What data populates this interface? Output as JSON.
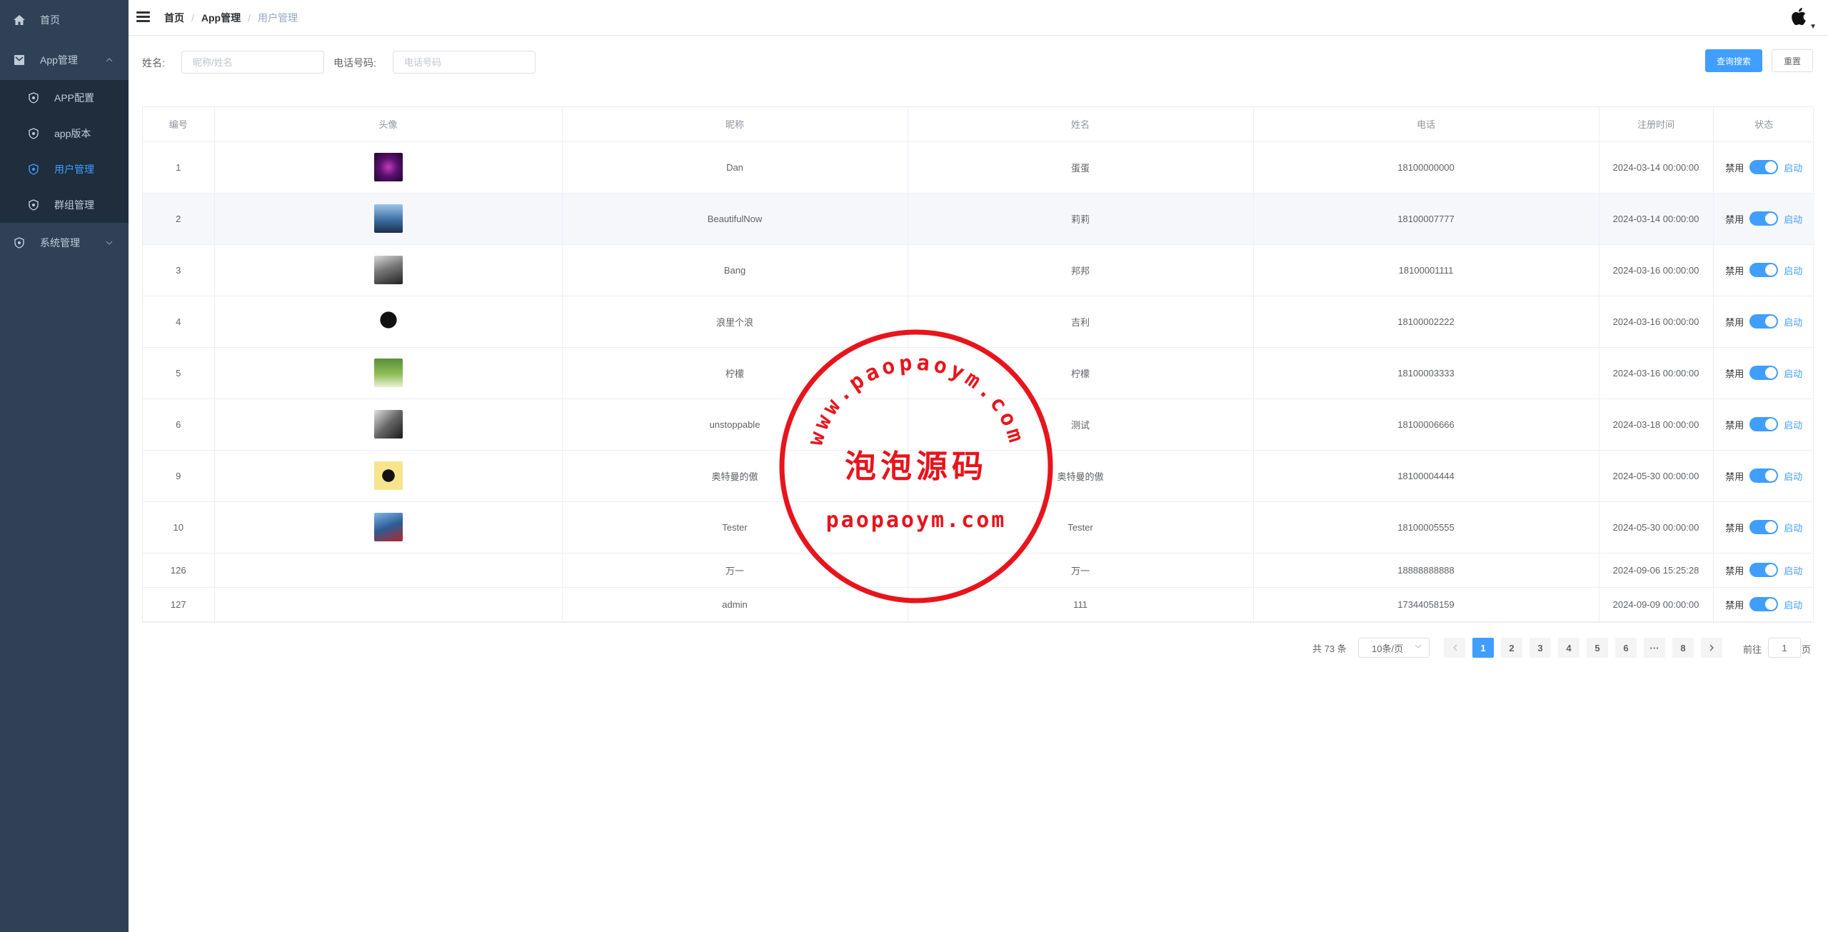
{
  "sidebar": {
    "items": [
      {
        "label": "首页",
        "icon": "home-icon"
      },
      {
        "label": "App管理",
        "icon": "app-icon",
        "expanded": true
      },
      {
        "label": "系统管理",
        "icon": "shield-icon",
        "expanded": false
      }
    ],
    "submenu": [
      {
        "label": "APP配置",
        "active": false
      },
      {
        "label": "app版本",
        "active": false
      },
      {
        "label": "用户管理",
        "active": true
      },
      {
        "label": "群组管理",
        "active": false
      }
    ]
  },
  "navbar": {
    "breadcrumb": [
      "首页",
      "App管理",
      "用户管理"
    ]
  },
  "search": {
    "name_label": "姓名:",
    "name_placeholder": "昵称/姓名",
    "phone_label": "电话号码:",
    "phone_placeholder": "电话号码",
    "search_button": "查询搜索",
    "reset_button": "重置"
  },
  "table": {
    "headers": [
      "编号",
      "头像",
      "昵称",
      "姓名",
      "电话",
      "注册时间",
      "状态"
    ],
    "rows": [
      {
        "id": "1",
        "nickname": "Dan",
        "name": "蛋蛋",
        "phone": "18100000000",
        "time": "2024-03-14 00:00:00",
        "has_avatar": true
      },
      {
        "id": "2",
        "nickname": "BeautifulNow",
        "name": "莉莉",
        "phone": "18100007777",
        "time": "2024-03-14 00:00:00",
        "has_avatar": true
      },
      {
        "id": "3",
        "nickname": "Bang",
        "name": "邦邦",
        "phone": "18100001111",
        "time": "2024-03-16 00:00:00",
        "has_avatar": true
      },
      {
        "id": "4",
        "nickname": "浪里个浪",
        "name": "吉利",
        "phone": "18100002222",
        "time": "2024-03-16 00:00:00",
        "has_avatar": true
      },
      {
        "id": "5",
        "nickname": "柠檬",
        "name": "柠檬",
        "phone": "18100003333",
        "time": "2024-03-16 00:00:00",
        "has_avatar": true
      },
      {
        "id": "6",
        "nickname": "unstoppable",
        "name": "测试",
        "phone": "18100006666",
        "time": "2024-03-18 00:00:00",
        "has_avatar": true
      },
      {
        "id": "9",
        "nickname": "奥特曼的傲",
        "name": "奥特曼的傲",
        "phone": "18100004444",
        "time": "2024-05-30 00:00:00",
        "has_avatar": true
      },
      {
        "id": "10",
        "nickname": "Tester",
        "name": "Tester",
        "phone": "18100005555",
        "time": "2024-05-30 00:00:00",
        "has_avatar": true
      },
      {
        "id": "126",
        "nickname": "万一",
        "name": "万一",
        "phone": "18888888888",
        "time": "2024-09-06 15:25:28",
        "has_avatar": false
      },
      {
        "id": "127",
        "nickname": "admin",
        "name": "111",
        "phone": "17344058159",
        "time": "2024-09-09 00:00:00",
        "has_avatar": false
      }
    ],
    "status_off": "禁用",
    "status_on": "启动",
    "status_enabled": true
  },
  "pagination": {
    "total": "共 73 条",
    "page_size": "10条/页",
    "pages": [
      "1",
      "2",
      "3",
      "4",
      "5",
      "6",
      "···",
      "8"
    ],
    "current": "1",
    "goto_label": "前往",
    "goto_value": "1",
    "page_unit": "页"
  },
  "watermark": {
    "arc_text": "www.paopaoym.com",
    "center_text": "泡泡源码",
    "bottom_text": "paopaoym.com",
    "color": "#e8141c"
  },
  "colors": {
    "sidebar_bg": "#304156",
    "submenu_bg": "#1f2d3d",
    "accent": "#409eff"
  }
}
